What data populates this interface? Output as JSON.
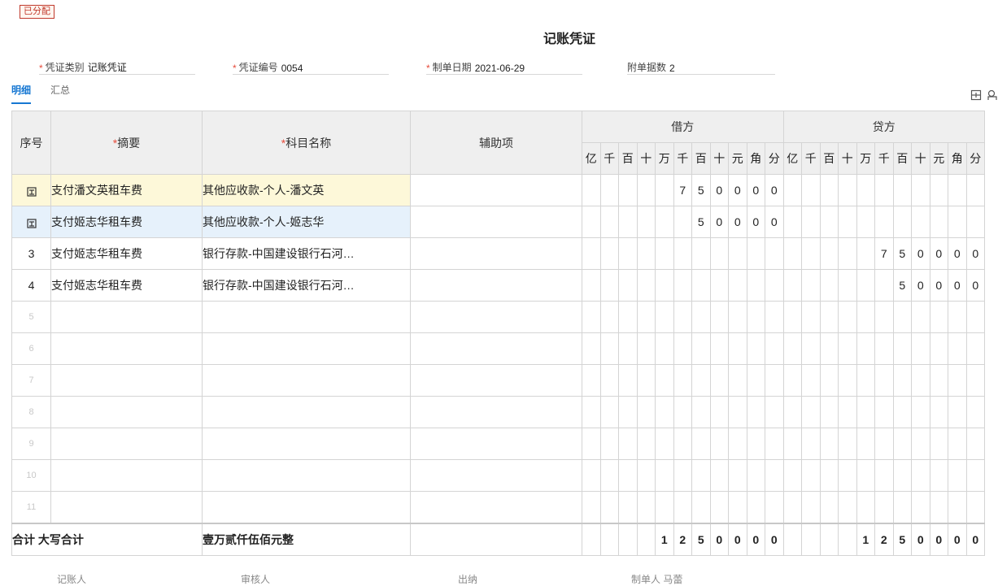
{
  "status_badge": "已分配",
  "title": "记账凭证",
  "fields": [
    {
      "label": "凭证类别",
      "value": "记账凭证",
      "required": true
    },
    {
      "label": "凭证编号",
      "value": "0054",
      "required": true
    },
    {
      "label": "制单日期",
      "value": "2021-06-29",
      "required": true
    },
    {
      "label": "附单据数",
      "value": "2",
      "required": false
    }
  ],
  "tabs": [
    {
      "label": "明细",
      "active": true
    },
    {
      "label": "汇总",
      "active": false
    }
  ],
  "columns": {
    "index": "序号",
    "summary": "摘要",
    "account": "科目名称",
    "auxiliary": "辅助项",
    "debit": "借方",
    "credit": "贷方",
    "digit_units": [
      "亿",
      "千",
      "百",
      "十",
      "万",
      "千",
      "百",
      "十",
      "元",
      "角",
      "分"
    ]
  },
  "rows": [
    {
      "index": "",
      "summary": "支付潘文英租车费",
      "account": "其他应收款-个人-潘文英",
      "auxiliary": "",
      "debit": [
        "",
        "",
        "",
        "",
        "",
        "7",
        "5",
        "0",
        "0",
        "0",
        "0"
      ],
      "credit": [
        "",
        "",
        "",
        "",
        "",
        "",
        "",
        "",
        "",
        "",
        ""
      ],
      "state": "selected"
    },
    {
      "index": "",
      "summary": "支付姬志华租车费",
      "account": "其他应收款-个人-姬志华",
      "auxiliary": "",
      "debit": [
        "",
        "",
        "",
        "",
        "",
        "",
        "5",
        "0",
        "0",
        "0",
        "0"
      ],
      "credit": [
        "",
        "",
        "",
        "",
        "",
        "",
        "",
        "",
        "",
        "",
        ""
      ],
      "state": "highlight"
    },
    {
      "index": "3",
      "summary": "支付姬志华租车费",
      "account": "银行存款-中国建设银行石河…",
      "auxiliary": "",
      "debit": [
        "",
        "",
        "",
        "",
        "",
        "",
        "",
        "",
        "",
        "",
        ""
      ],
      "credit": [
        "",
        "",
        "",
        "",
        "",
        "7",
        "5",
        "0",
        "0",
        "0",
        "0"
      ],
      "state": ""
    },
    {
      "index": "4",
      "summary": "支付姬志华租车费",
      "account": "银行存款-中国建设银行石河…",
      "auxiliary": "",
      "debit": [
        "",
        "",
        "",
        "",
        "",
        "",
        "",
        "",
        "",
        "",
        ""
      ],
      "credit": [
        "",
        "",
        "",
        "",
        "",
        "",
        "5",
        "0",
        "0",
        "0",
        "0"
      ],
      "state": ""
    },
    {
      "index": "5",
      "summary": "",
      "account": "",
      "auxiliary": "",
      "debit": [
        "",
        "",
        "",
        "",
        "",
        "",
        "",
        "",
        "",
        "",
        ""
      ],
      "credit": [
        "",
        "",
        "",
        "",
        "",
        "",
        "",
        "",
        "",
        "",
        ""
      ],
      "state": "empty"
    },
    {
      "index": "6",
      "summary": "",
      "account": "",
      "auxiliary": "",
      "debit": [
        "",
        "",
        "",
        "",
        "",
        "",
        "",
        "",
        "",
        "",
        ""
      ],
      "credit": [
        "",
        "",
        "",
        "",
        "",
        "",
        "",
        "",
        "",
        "",
        ""
      ],
      "state": "empty"
    },
    {
      "index": "7",
      "summary": "",
      "account": "",
      "auxiliary": "",
      "debit": [
        "",
        "",
        "",
        "",
        "",
        "",
        "",
        "",
        "",
        "",
        ""
      ],
      "credit": [
        "",
        "",
        "",
        "",
        "",
        "",
        "",
        "",
        "",
        "",
        ""
      ],
      "state": "empty"
    },
    {
      "index": "8",
      "summary": "",
      "account": "",
      "auxiliary": "",
      "debit": [
        "",
        "",
        "",
        "",
        "",
        "",
        "",
        "",
        "",
        "",
        ""
      ],
      "credit": [
        "",
        "",
        "",
        "",
        "",
        "",
        "",
        "",
        "",
        "",
        ""
      ],
      "state": "empty"
    },
    {
      "index": "9",
      "summary": "",
      "account": "",
      "auxiliary": "",
      "debit": [
        "",
        "",
        "",
        "",
        "",
        "",
        "",
        "",
        "",
        "",
        ""
      ],
      "credit": [
        "",
        "",
        "",
        "",
        "",
        "",
        "",
        "",
        "",
        "",
        ""
      ],
      "state": "empty"
    },
    {
      "index": "10",
      "summary": "",
      "account": "",
      "auxiliary": "",
      "debit": [
        "",
        "",
        "",
        "",
        "",
        "",
        "",
        "",
        "",
        "",
        ""
      ],
      "credit": [
        "",
        "",
        "",
        "",
        "",
        "",
        "",
        "",
        "",
        "",
        ""
      ],
      "state": "empty"
    },
    {
      "index": "11",
      "summary": "",
      "account": "",
      "auxiliary": "",
      "debit": [
        "",
        "",
        "",
        "",
        "",
        "",
        "",
        "",
        "",
        "",
        ""
      ],
      "credit": [
        "",
        "",
        "",
        "",
        "",
        "",
        "",
        "",
        "",
        "",
        ""
      ],
      "state": "empty"
    }
  ],
  "total": {
    "label": "合计 大写合计",
    "amount_words": "壹万贰仟伍佰元整",
    "debit": [
      "",
      "",
      "",
      "",
      "",
      "1",
      "2",
      "5",
      "0",
      "0",
      "0",
      "0"
    ],
    "credit": [
      "",
      "",
      "",
      "",
      "",
      "1",
      "2",
      "5",
      "0",
      "0",
      "0",
      "0"
    ]
  },
  "footer": [
    "记账人",
    "审核人",
    "出纳",
    "制单人 马蕾"
  ],
  "icons": {
    "row_insert": "insert-row-icon",
    "tool1": "table-settings-icon",
    "tool2": "print-icon"
  },
  "colors": {
    "accent": "#1677d2",
    "required": "#e74c3c",
    "badge": "#c0392b",
    "selected_row": "#fdf8d9",
    "highlight_row": "#e6f1fb"
  }
}
